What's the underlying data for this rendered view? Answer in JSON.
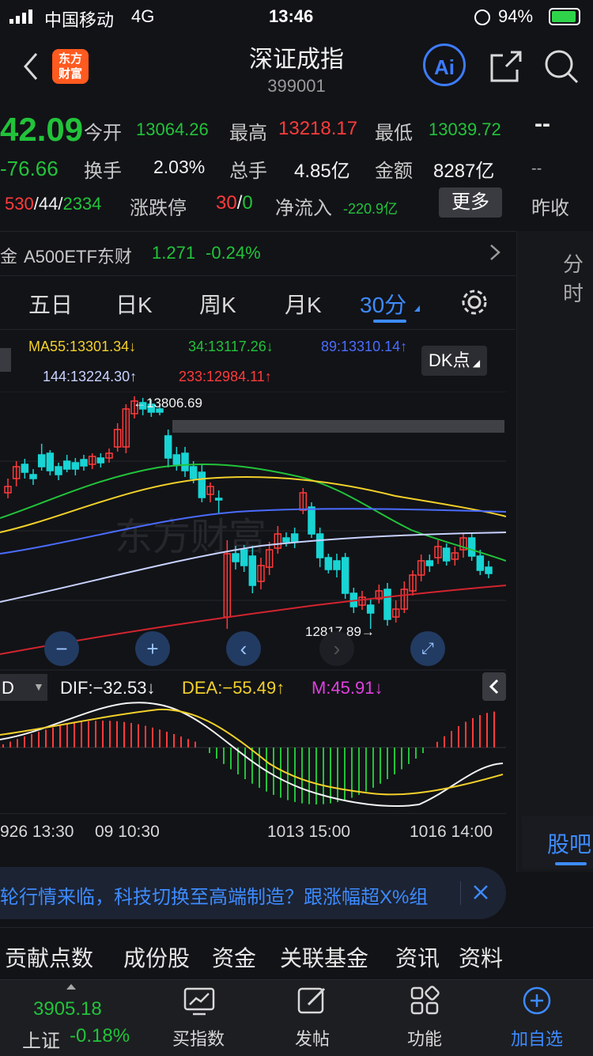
{
  "status": {
    "carrier": "中国移动",
    "network": "4G",
    "time": "13:46",
    "battery": "94%"
  },
  "header": {
    "logo_line1": "东方",
    "logo_line2": "财富",
    "title": "深证成指",
    "code": "399001",
    "ai": "Ai"
  },
  "quote": {
    "price": "42.09",
    "change": "-76.66",
    "open_label": "今开",
    "open": "13064.26",
    "high_label": "最高",
    "high": "13218.17",
    "low_label": "最低",
    "low": "13039.72",
    "turnover_label": "换手",
    "turnover": "2.03%",
    "volume_label": "总手",
    "volume": "4.85亿",
    "amount_label": "金额",
    "amount": "8287亿",
    "breadth_up": "530",
    "breadth_flat": "44",
    "breadth_down": "2334",
    "limit_label": "涨跌停",
    "limit_up": "30",
    "limit_down": "0",
    "netflow_label": "净流入",
    "netflow": "-220.9亿",
    "more": "更多",
    "prev_close_value": "--",
    "right_dash": "--",
    "prev_close_label": "昨收"
  },
  "etf": {
    "prefix": "金",
    "name": "A500ETF东财",
    "price": "1.271",
    "change": "-0.24%"
  },
  "right_panel": {
    "top_label": "分时",
    "bottom_label": "股吧"
  },
  "tabs": [
    "五日",
    "日K",
    "周K",
    "月K",
    "30分"
  ],
  "ma": {
    "ma55": "MA55:13301.34↓",
    "ma34": "34:13117.26↓",
    "ma89": "89:13310.14↑",
    "ma144": "144:13224.30↑",
    "ma233": "233:12984.11↑"
  },
  "dk": "DK点",
  "chart_annotations": {
    "high_mark": "←13806.69",
    "low_mark": "12817.89→"
  },
  "macd": {
    "dif": "DIF:−32.53↓",
    "dea": "DEA:−55.49↑",
    "m": "M:45.91↓",
    "selector": "D"
  },
  "time_axis": [
    "926 13:30",
    "09 10:30",
    "1013 15:00",
    "1016 14:00"
  ],
  "banner": {
    "text": "轮行情来临，科技切换至高端制造？跟涨幅超X%组"
  },
  "bottom_tabs": [
    "贡献点数",
    "成份股",
    "资金",
    "关联基金",
    "资讯",
    "资料"
  ],
  "nav": {
    "index_value": "3905.18",
    "index_name": "上证",
    "index_change": "-0.18%",
    "items": [
      "买指数",
      "发帖",
      "功能",
      "加自选"
    ]
  },
  "colors": {
    "up": "#ff3b3b",
    "down": "#22c33a",
    "accent": "#3d8bff",
    "cyan": "#19d4d4"
  }
}
